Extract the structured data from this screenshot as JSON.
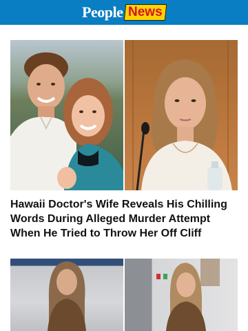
{
  "header": {
    "logo_primary": "People",
    "logo_secondary": "News"
  },
  "article": {
    "headline": "Hawaii Doctor's Wife Reveals His Chilling Words During Alleged Murder Attempt When He Tried to Throw Her Off Cliff"
  },
  "colors": {
    "brand_blue": "#0a7ec2",
    "news_yellow": "#ffd200",
    "news_red": "#d3132a"
  }
}
